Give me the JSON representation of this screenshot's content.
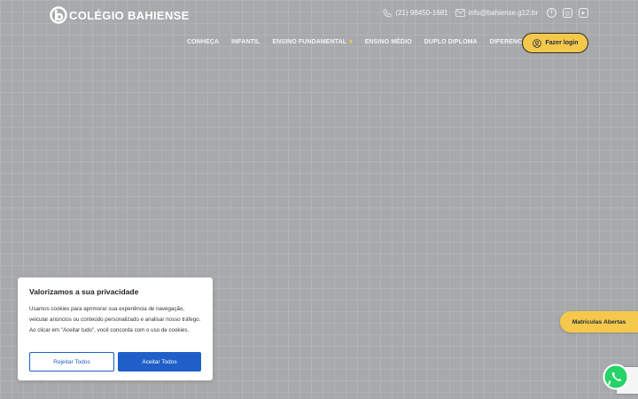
{
  "brand": {
    "name": "COLÉGIO BAHIENSE"
  },
  "contact": {
    "phone": "(21) 98450-1681",
    "email": "info@bahiense.g12.br"
  },
  "social": {
    "facebook": "f",
    "instagram": "◎",
    "youtube": "▶"
  },
  "nav": {
    "items": [
      {
        "label": "CONHEÇA"
      },
      {
        "label": "INFANTIL"
      },
      {
        "label": "ENSINO FUNDAMENTAL",
        "dropdown": "▾"
      },
      {
        "label": "ENSINO MÉDIO"
      },
      {
        "label": "DUPLO DIPLOMA"
      },
      {
        "label": "DIFERENCIAIS",
        "dropdown": "▾"
      }
    ],
    "login_label": "Fazer login"
  },
  "cookie": {
    "title": "Valorizamos a sua privacidade",
    "text": "Usamos cookies para aprimorar sua experiência de navegação, veicular anúncios ou conteúdo personalizado e analisar nosso tráfego. Ao clicar em \"Aceitar tudo\", você concorda com o uso de cookies.",
    "reject_label": "Rejeitar Todos",
    "accept_label": "Aceitar Todos"
  },
  "cta": {
    "matriculas_label": "Matrículas Abertas"
  },
  "colors": {
    "accent": "#f4c84a",
    "primary": "#1f5fc7",
    "background": "#a8a9ab",
    "whatsapp": "#25d366"
  }
}
